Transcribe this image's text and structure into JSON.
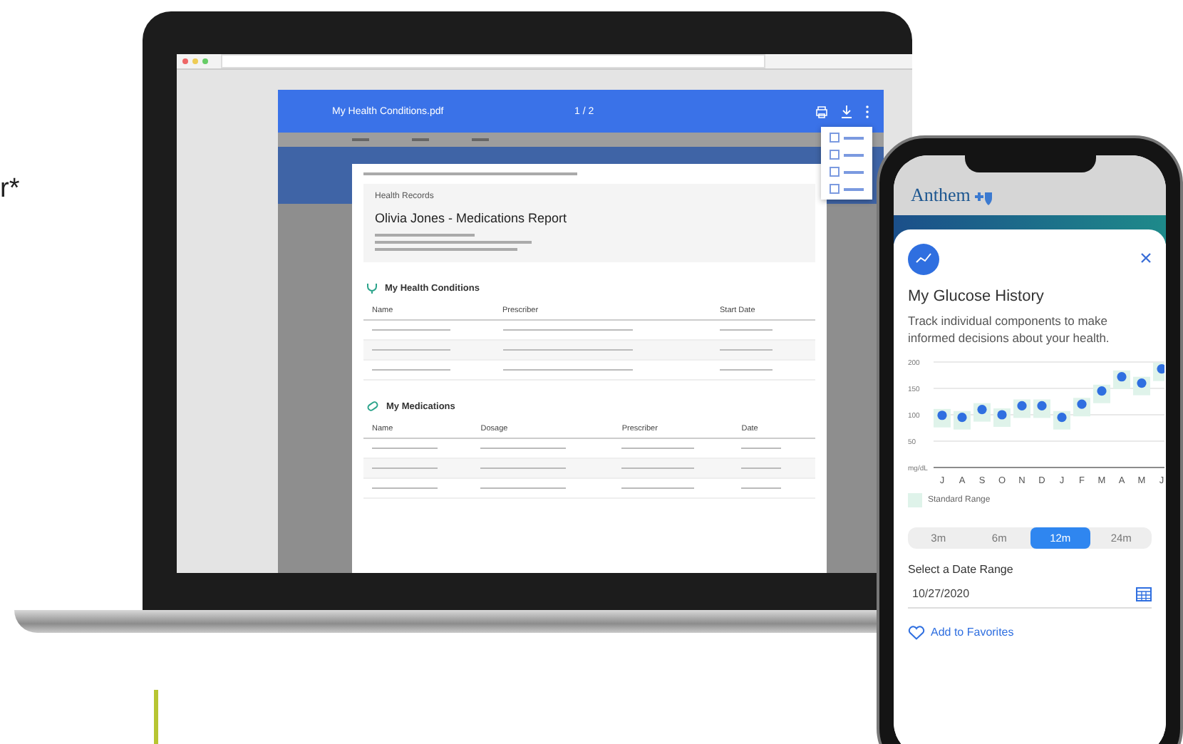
{
  "side_text": "r*",
  "laptop": {
    "viewer": {
      "file_name": "My Health Conditions.pdf",
      "page_indicator": "1 / 2",
      "menu_open": true
    },
    "report": {
      "section_label": "Health Records",
      "title": "Olivia Jones - Medications Report",
      "sections": [
        {
          "kind": "conditions",
          "title": "My Health Conditions",
          "columns": [
            "Name",
            "Prescriber",
            "Start Date"
          ]
        },
        {
          "kind": "medications",
          "title": "My Medications",
          "columns": [
            "Name",
            "Dosage",
            "Prescriber",
            "Date"
          ]
        }
      ]
    }
  },
  "phone": {
    "brand": "Anthem",
    "card": {
      "title": "My Glucose History",
      "description": "Track individual components to make informed decisions about your health.",
      "chart_data": {
        "type": "scatter",
        "ylabel": "mg/dL",
        "categories": [
          "J",
          "A",
          "S",
          "O",
          "N",
          "D",
          "J",
          "F",
          "M",
          "A",
          "M",
          "J"
        ],
        "ylim": [
          0,
          200
        ],
        "yticks": [
          50,
          100,
          150,
          200
        ],
        "grid": true,
        "series": [
          {
            "color": "#2f6fe0",
            "values": [
              99,
              95,
              110,
              100,
              117,
              117,
              95,
              120,
              145,
              172,
              160,
              187
            ]
          }
        ]
      },
      "legend": "Standard Range",
      "ranges": [
        {
          "label": "3m",
          "selected": false
        },
        {
          "label": "6m",
          "selected": false
        },
        {
          "label": "12m",
          "selected": true
        },
        {
          "label": "24m",
          "selected": false
        }
      ],
      "date_label": "Select a Date Range",
      "date_value": "10/27/2020",
      "favorite": "Add to Favorites"
    }
  }
}
